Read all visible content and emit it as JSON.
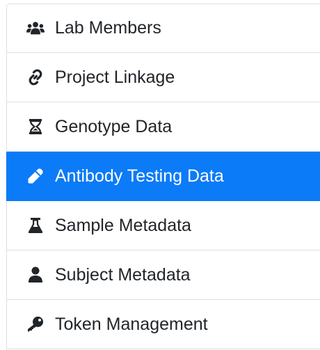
{
  "nav": {
    "items": [
      {
        "label": "Lab Members",
        "icon": "users-icon",
        "active": false
      },
      {
        "label": "Project Linkage",
        "icon": "link-icon",
        "active": false
      },
      {
        "label": "Genotype Data",
        "icon": "hourglass-icon",
        "active": false
      },
      {
        "label": "Antibody Testing Data",
        "icon": "eyedropper-icon",
        "active": true
      },
      {
        "label": "Sample Metadata",
        "icon": "flask-icon",
        "active": false
      },
      {
        "label": "Subject Metadata",
        "icon": "user-icon",
        "active": false
      },
      {
        "label": "Token Management",
        "icon": "key-icon",
        "active": false
      }
    ]
  },
  "colors": {
    "active_bg": "#0b7bf7",
    "active_text": "#ffffff",
    "text": "#212529",
    "border": "#dfdfdf"
  }
}
